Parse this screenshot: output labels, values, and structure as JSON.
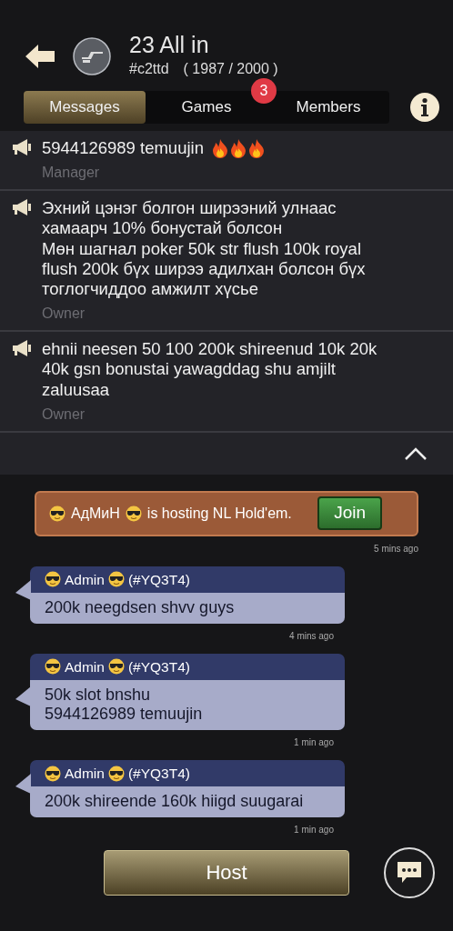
{
  "header": {
    "title": "23 All in",
    "club_id": "#c2ttd",
    "capacity": "( 1987 / 2000 )"
  },
  "tabs": [
    {
      "label": "Messages",
      "selected": true
    },
    {
      "label": "Games",
      "selected": false,
      "badge": "3"
    },
    {
      "label": "Members",
      "selected": false
    }
  ],
  "announcements": [
    {
      "text": "5944126989 temuujin",
      "kind": "fire",
      "role": "Manager"
    },
    {
      "text": "Эхний цэнэг болгон ширээний улнаас хамаарч 10% бонустай болсон\nМөн шагнал poker 50k str flush 100k royal flush 200k бүх ширээ адилхан болсон бүх тоглогчиддоо амжилт хүсье",
      "kind": "plain",
      "role": "Owner"
    },
    {
      "text": "ehnii neesen 50 100 200k shireenud 10k 20k 40k gsn bonustai yawagddag shu amjilt zaluusaa",
      "kind": "plain",
      "role": "Owner"
    }
  ],
  "game_invite": {
    "host": "АдМиН",
    "text": "is hosting NL Hold'em.",
    "button": "Join",
    "time": "5 mins ago"
  },
  "messages": [
    {
      "sender": "Admin",
      "sender_id": "(#YQ3T4)",
      "text": "200k neegdsen shvv guys",
      "time": "4 mins ago"
    },
    {
      "sender": "Admin",
      "sender_id": "(#YQ3T4)",
      "text": "50k slot bnshu\n5944126989 temuujin",
      "time": "1 min ago"
    },
    {
      "sender": "Admin",
      "sender_id": "(#YQ3T4)",
      "text": "200k shireende 160k hiigd suugarai",
      "time": "1 min ago"
    }
  ],
  "host_button": "Host"
}
